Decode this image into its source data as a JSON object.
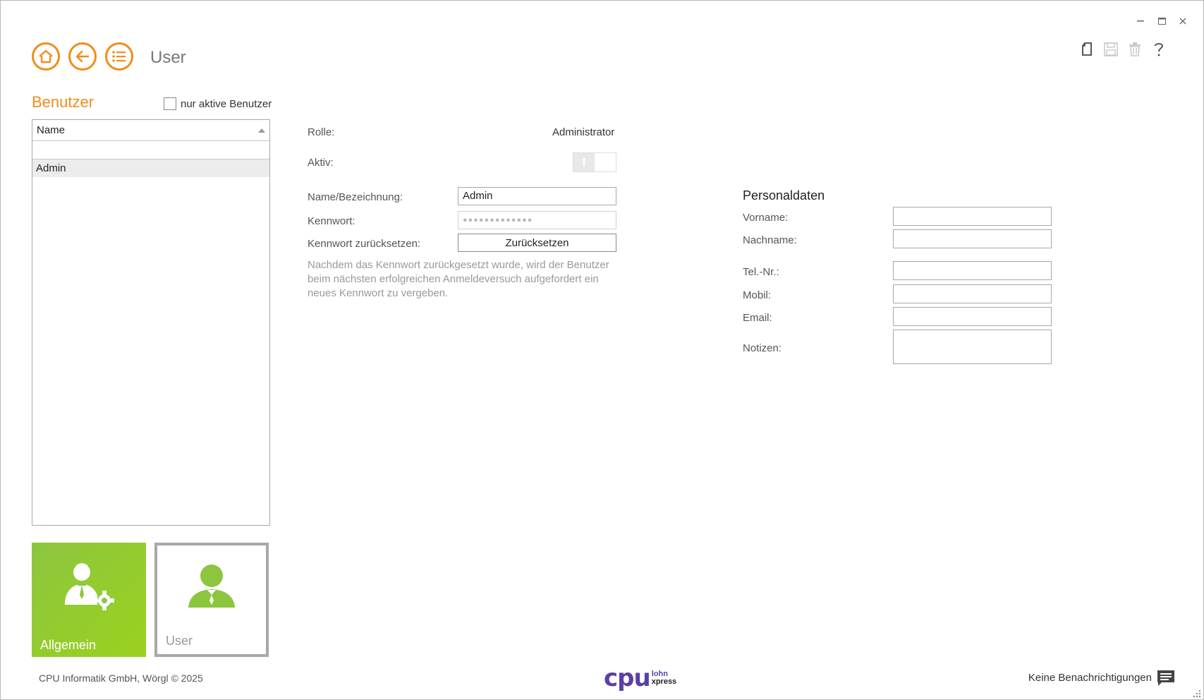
{
  "window": {
    "title": "User",
    "controls": [
      "minimize",
      "maximize",
      "close"
    ]
  },
  "nav": {
    "home_icon": "home-icon",
    "back_icon": "arrow-left-icon",
    "menu_icon": "list-icon"
  },
  "toolbar": {
    "icons": [
      "new-document-icon",
      "save-icon",
      "trash-icon",
      "help-icon"
    ]
  },
  "users_panel": {
    "heading": "Benutzer",
    "filter_label": "nur aktive Benutzer",
    "filter_checked": false,
    "column_header": "Name",
    "items": [
      "Admin"
    ]
  },
  "tiles": [
    {
      "label": "Allgemein",
      "icon": "user-settings-icon",
      "active": true
    },
    {
      "label": "User",
      "icon": "user-icon",
      "active": false
    }
  ],
  "form": {
    "role_label": "Rolle:",
    "role_value": "Administrator",
    "active_label": "Aktiv:",
    "active_value": true,
    "name_label": "Name/Bezeichnung:",
    "name_value": "Admin",
    "password_label": "Kennwort:",
    "password_value": "●●●●●●●●●●●●●",
    "reset_label": "Kennwort zurücksetzen:",
    "reset_button": "Zurücksetzen",
    "note_line1": "Nachdem das Kennwort zurückgesetzt wurde, wird der Benutzer",
    "note_line2": "beim nächsten erfolgreichen Anmeldeversuch aufgefordert ein",
    "note_line3": "neues Kennwort zu vergeben."
  },
  "personal": {
    "title": "Personaldaten",
    "firstname_label": "Vorname:",
    "lastname_label": "Nachname:",
    "phone_label": "Tel.-Nr.:",
    "mobile_label": "Mobil:",
    "email_label": "Email:",
    "notes_label": "Notizen:"
  },
  "footer": {
    "copyright": "CPU Informatik GmbH, Wörgl  ©  2025",
    "logo_main": "cpu",
    "logo_line1": "lohn",
    "logo_line2": "xpress",
    "notifications": "Keine Benachrichtigungen"
  },
  "colors": {
    "accent": "#f28c1a",
    "tile_green": "#8cc63f",
    "logo_purple": "#5b3fa6"
  }
}
